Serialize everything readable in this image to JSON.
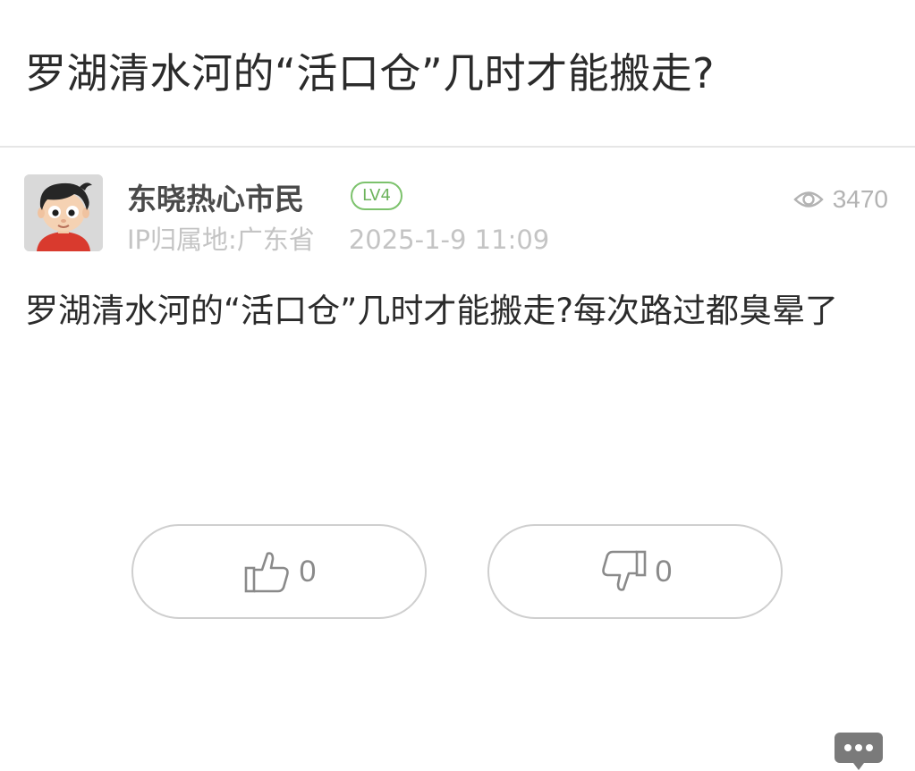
{
  "header": {
    "title": "罗湖清水河的“活口仓”几时才能搬走?"
  },
  "author": {
    "name": "东晓热心市民",
    "level": "LV4",
    "ip_location": "IP归属地:广东省",
    "datetime": "2025-1-9 11:09",
    "views": "3470"
  },
  "post": {
    "body": "罗湖清水河的“活口仓”几时才能搬走?每次路过都臭晕了"
  },
  "votes": {
    "likes": "0",
    "dislikes": "0"
  },
  "colors": {
    "level_badge": "#7cc26c",
    "comment_button": "#7a7a7a"
  },
  "icons": {
    "views": "eye-icon",
    "like": "thumbs-up-icon",
    "dislike": "thumbs-down-icon",
    "comment": "comment-bubble-icon"
  }
}
